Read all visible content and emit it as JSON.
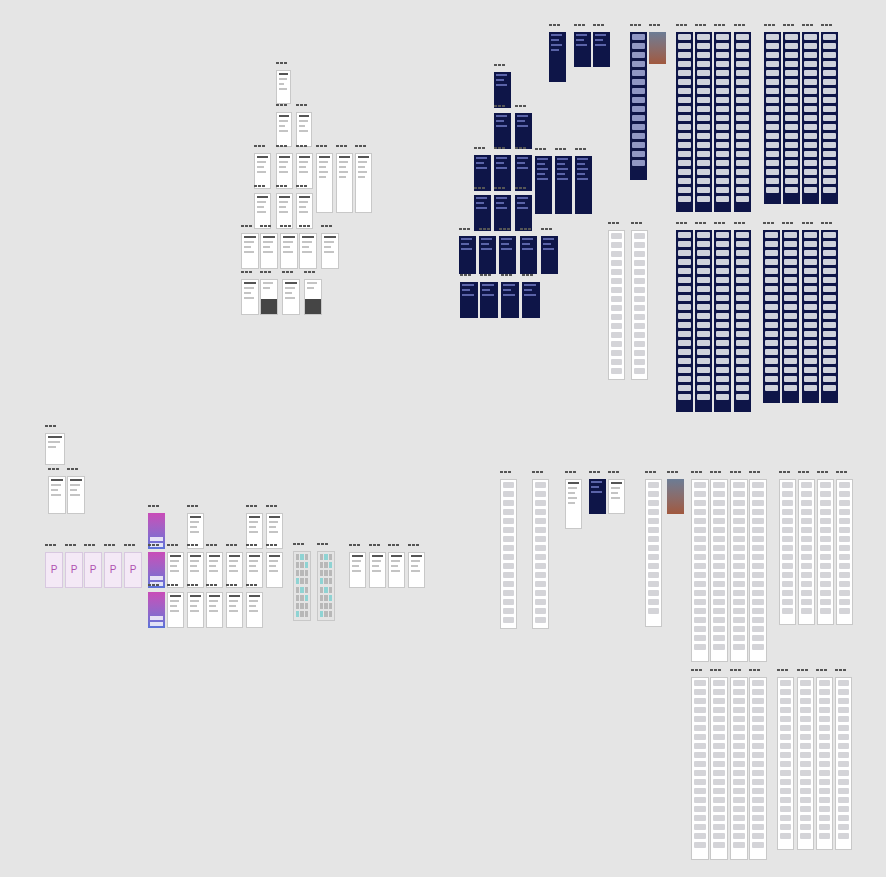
{
  "canvas": {
    "logo": "P",
    "groups": [
      {
        "kind": "light"
      },
      {
        "kind": "light"
      },
      {
        "kind": "light"
      },
      {
        "kind": "light"
      },
      {
        "kind": "light"
      },
      {
        "kind": "light"
      },
      {
        "kind": "light"
      },
      {
        "kind": "keyboard"
      },
      {
        "kind": "dark"
      },
      {
        "kind": "dark"
      },
      {
        "kind": "dark"
      },
      {
        "kind": "dark"
      },
      {
        "kind": "dark"
      },
      {
        "kind": "dark"
      },
      {
        "kind": "dark"
      },
      {
        "kind": "dark"
      },
      {
        "kind": "dark"
      },
      {
        "kind": "darklist"
      },
      {
        "kind": "photo"
      },
      {
        "kind": "darkfeed"
      },
      {
        "kind": "darkfeed"
      },
      {
        "kind": "feed"
      },
      {
        "kind": "darkfeed"
      },
      {
        "kind": "darkfeed"
      },
      {
        "kind": "light"
      },
      {
        "kind": "light"
      },
      {
        "kind": "pink"
      },
      {
        "kind": "gradient"
      },
      {
        "kind": "gradient"
      },
      {
        "kind": "gradient"
      },
      {
        "kind": "light"
      },
      {
        "kind": "light"
      },
      {
        "kind": "light"
      },
      {
        "kind": "keypad"
      },
      {
        "kind": "light"
      },
      {
        "kind": "feed"
      },
      {
        "kind": "light"
      },
      {
        "kind": "dark"
      },
      {
        "kind": "light"
      },
      {
        "kind": "feed"
      },
      {
        "kind": "photo"
      },
      {
        "kind": "feed"
      },
      {
        "kind": "feed"
      },
      {
        "kind": "feed"
      },
      {
        "kind": "feed"
      }
    ]
  }
}
